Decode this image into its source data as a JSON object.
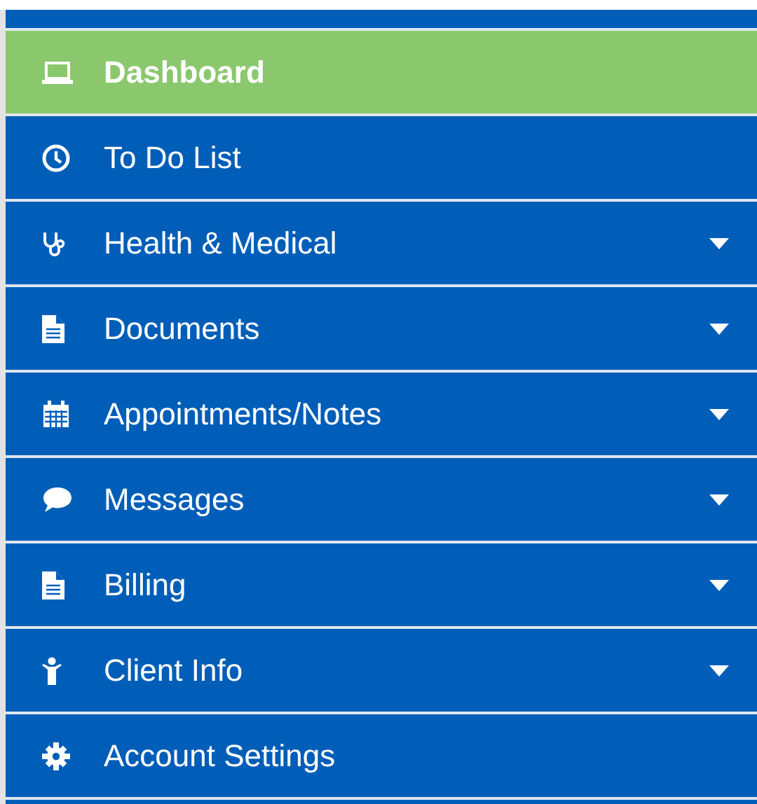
{
  "sidebar": {
    "items": [
      {
        "label": "Dashboard",
        "selected": true,
        "has_submenu": false
      },
      {
        "label": "To Do List",
        "selected": false,
        "has_submenu": false
      },
      {
        "label": "Health & Medical",
        "selected": false,
        "has_submenu": true
      },
      {
        "label": "Documents",
        "selected": false,
        "has_submenu": true
      },
      {
        "label": "Appointments/Notes",
        "selected": false,
        "has_submenu": true
      },
      {
        "label": "Messages",
        "selected": false,
        "has_submenu": true
      },
      {
        "label": "Billing",
        "selected": false,
        "has_submenu": true
      },
      {
        "label": "Client Info",
        "selected": false,
        "has_submenu": true
      },
      {
        "label": "Account Settings",
        "selected": false,
        "has_submenu": false
      }
    ]
  }
}
